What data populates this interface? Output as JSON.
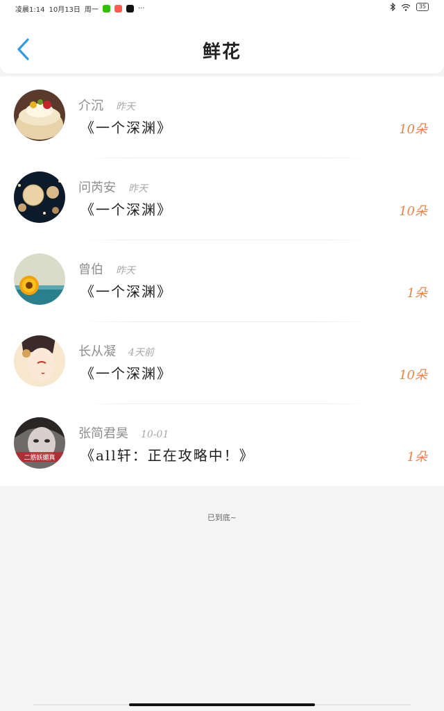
{
  "status_bar": {
    "time_text": "凌晨1:14",
    "date_text": "10月13日",
    "weekday_text": "周一",
    "more_text": "···",
    "battery_text": "35",
    "icons": [
      "wechat-icon",
      "app-icon",
      "tiktok-icon",
      "bluetooth-icon",
      "wifi-icon",
      "battery-icon"
    ]
  },
  "header": {
    "title": "鲜花",
    "back_icon": "chevron-left-icon",
    "accent_color": "#2f9be6"
  },
  "items": [
    {
      "name": "介沉",
      "time": "昨天",
      "work": "《一个深渊》",
      "count": "10朵",
      "avatar": "cake"
    },
    {
      "name": "问芮安",
      "time": "昨天",
      "work": "《一个深渊》",
      "count": "10朵",
      "avatar": "lanterns"
    },
    {
      "name": "曾伯",
      "time": "昨天",
      "work": "《一个深渊》",
      "count": "1朵",
      "avatar": "sunflower"
    },
    {
      "name": "长从凝",
      "time": "4天前",
      "work": "《一个深渊》",
      "count": "10朵",
      "avatar": "anime-girl"
    },
    {
      "name": "张简君昊",
      "time": "10-01",
      "work": "《all轩：正在攻略中！》",
      "count": "1朵",
      "avatar": "portrait",
      "avatar_caption": "二筋妖媚真"
    }
  ],
  "footer": {
    "text": "已到底~"
  },
  "colors": {
    "count": "#e6854a",
    "name": "#8e8e8e",
    "background": "#f6f5f5"
  }
}
